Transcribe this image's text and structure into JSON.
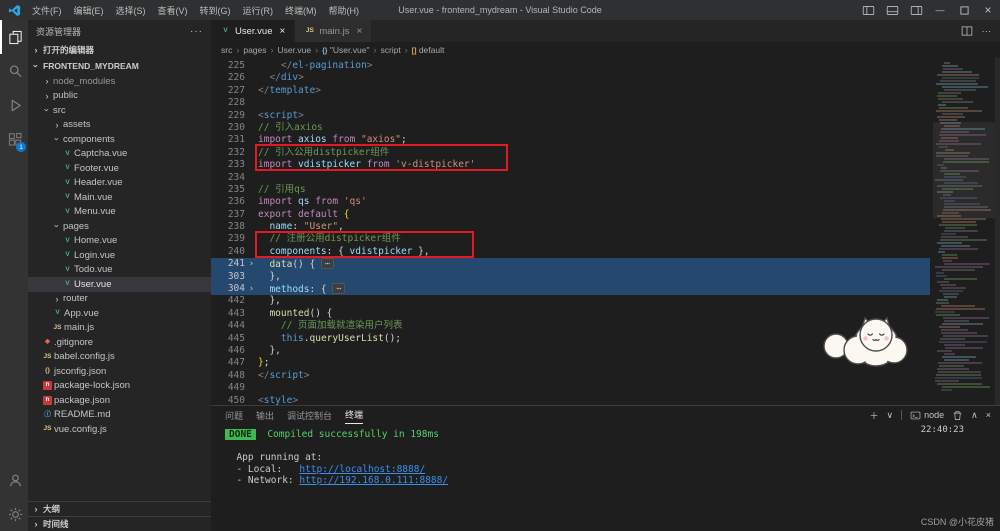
{
  "title_bar": {
    "menus": [
      {
        "name": "file",
        "label": "文件(F)"
      },
      {
        "name": "edit",
        "label": "编辑(E)"
      },
      {
        "name": "selection",
        "label": "选择(S)"
      },
      {
        "name": "view",
        "label": "查看(V)"
      },
      {
        "name": "go",
        "label": "转到(G)"
      },
      {
        "name": "run",
        "label": "运行(R)"
      },
      {
        "name": "terminal",
        "label": "终端(M)"
      },
      {
        "name": "help",
        "label": "帮助(H)"
      }
    ],
    "title": "User.vue - frontend_mydream - Visual Studio Code"
  },
  "activity_bar": {
    "badge": "1"
  },
  "sidebar": {
    "title": "资源管理器",
    "open_editors_label": "打开的编辑器",
    "project_label": "FRONTEND_MYDREAM",
    "outline_label": "大纲",
    "timeline_label": "时间线",
    "tree": [
      {
        "label": "node_modules",
        "type": "folder",
        "depth": 1,
        "expanded": false,
        "dim": true
      },
      {
        "label": "public",
        "type": "folder",
        "depth": 1,
        "expanded": false
      },
      {
        "label": "src",
        "type": "folder",
        "depth": 1,
        "expanded": true
      },
      {
        "label": "assets",
        "type": "folder",
        "depth": 2,
        "expanded": false
      },
      {
        "label": "components",
        "type": "folder",
        "depth": 2,
        "expanded": true
      },
      {
        "label": "Captcha.vue",
        "type": "vue",
        "depth": 3
      },
      {
        "label": "Footer.vue",
        "type": "vue",
        "depth": 3
      },
      {
        "label": "Header.vue",
        "type": "vue",
        "depth": 3
      },
      {
        "label": "Main.vue",
        "type": "vue",
        "depth": 3
      },
      {
        "label": "Menu.vue",
        "type": "vue",
        "depth": 3
      },
      {
        "label": "pages",
        "type": "folder",
        "depth": 2,
        "expanded": true
      },
      {
        "label": "Home.vue",
        "type": "vue",
        "depth": 3
      },
      {
        "label": "Login.vue",
        "type": "vue",
        "depth": 3
      },
      {
        "label": "Todo.vue",
        "type": "vue",
        "depth": 3
      },
      {
        "label": "User.vue",
        "type": "vue",
        "depth": 3,
        "selected": true
      },
      {
        "label": "router",
        "type": "folder",
        "depth": 2,
        "expanded": false
      },
      {
        "label": "App.vue",
        "type": "vue",
        "depth": 2
      },
      {
        "label": "main.js",
        "type": "js",
        "depth": 2
      },
      {
        "label": ".gitignore",
        "type": "git",
        "depth": 1
      },
      {
        "label": "babel.config.js",
        "type": "js",
        "depth": 1
      },
      {
        "label": "jsconfig.json",
        "type": "json",
        "depth": 1
      },
      {
        "label": "package-lock.json",
        "type": "npm",
        "depth": 1
      },
      {
        "label": "package.json",
        "type": "npm",
        "depth": 1
      },
      {
        "label": "README.md",
        "type": "md",
        "depth": 1
      },
      {
        "label": "vue.config.js",
        "type": "js",
        "depth": 1
      }
    ]
  },
  "editor": {
    "tabs": [
      {
        "label": "User.vue",
        "icon": "vue",
        "active": true
      },
      {
        "label": "main.js",
        "icon": "js",
        "active": false
      }
    ],
    "breadcrumb": [
      {
        "label": "src"
      },
      {
        "label": "pages"
      },
      {
        "label": "User.vue"
      },
      {
        "label": "\"User.vue\"",
        "icon": "{}",
        "icon_color": "#8fb8d8"
      },
      {
        "label": "script"
      },
      {
        "label": "default",
        "icon": "[]",
        "icon_color": "#e8ab53"
      }
    ],
    "lines": [
      {
        "num": 225,
        "tokens": [
          [
            "p",
            "    </"
          ],
          [
            "t",
            "el-pagination"
          ],
          [
            "p",
            ">"
          ]
        ]
      },
      {
        "num": 226,
        "tokens": [
          [
            "p",
            "  </"
          ],
          [
            "t",
            "div"
          ],
          [
            "p",
            ">"
          ]
        ]
      },
      {
        "num": 227,
        "tokens": [
          [
            "p",
            "</"
          ],
          [
            "t",
            "template"
          ],
          [
            "p",
            ">"
          ]
        ]
      },
      {
        "num": 228,
        "tokens": []
      },
      {
        "num": 229,
        "tokens": [
          [
            "p",
            "<"
          ],
          [
            "t",
            "script"
          ],
          [
            "p",
            ">"
          ]
        ]
      },
      {
        "num": 230,
        "tokens": [
          [
            "c",
            "// 引入axios"
          ]
        ]
      },
      {
        "num": 231,
        "tokens": [
          [
            "k",
            "import "
          ],
          [
            "v",
            "axios "
          ],
          [
            "k",
            "from "
          ],
          [
            "s",
            "\"axios\""
          ],
          [
            "w",
            ";"
          ]
        ]
      },
      {
        "num": 232,
        "tokens": [
          [
            "c",
            "// 引入公用distpicker组件"
          ]
        ]
      },
      {
        "num": 233,
        "tokens": [
          [
            "k",
            "import "
          ],
          [
            "v",
            "vdistpicker "
          ],
          [
            "k",
            "from "
          ],
          [
            "s",
            "'v-distpicker'"
          ]
        ]
      },
      {
        "num": 234,
        "tokens": []
      },
      {
        "num": 235,
        "tokens": [
          [
            "c",
            "// 引用qs"
          ]
        ]
      },
      {
        "num": 236,
        "tokens": [
          [
            "k",
            "import "
          ],
          [
            "v",
            "qs "
          ],
          [
            "k",
            "from "
          ],
          [
            "s",
            "'qs'"
          ]
        ]
      },
      {
        "num": 237,
        "tokens": [
          [
            "k",
            "export default "
          ],
          [
            "y",
            "{"
          ]
        ]
      },
      {
        "num": 238,
        "tokens": [
          [
            "v",
            "  name"
          ],
          [
            "w",
            ": "
          ],
          [
            "s",
            "\"User\""
          ],
          [
            "w",
            ","
          ]
        ]
      },
      {
        "num": 239,
        "tokens": [
          [
            "c",
            "  // 注册公用distpicker组件"
          ]
        ]
      },
      {
        "num": 240,
        "tokens": [
          [
            "v",
            "  components"
          ],
          [
            "w",
            ": { "
          ],
          [
            "v",
            "vdistpicker"
          ],
          [
            "w",
            " },"
          ]
        ]
      },
      {
        "num": 241,
        "sel": true,
        "fold": true,
        "tokens": [
          [
            "f",
            "  data"
          ],
          [
            "w",
            "() { "
          ],
          [
            "fold",
            "⋯"
          ]
        ]
      },
      {
        "num": 303,
        "sel": true,
        "tokens": [
          [
            "w",
            "  },"
          ]
        ]
      },
      {
        "num": 304,
        "sel": true,
        "fold": true,
        "tokens": [
          [
            "v",
            "  methods"
          ],
          [
            "w",
            ": { "
          ],
          [
            "fold",
            "⋯"
          ]
        ]
      },
      {
        "num": 442,
        "tokens": [
          [
            "w",
            "  },"
          ]
        ]
      },
      {
        "num": 443,
        "tokens": [
          [
            "f",
            "  mounted"
          ],
          [
            "w",
            "() {"
          ]
        ]
      },
      {
        "num": 444,
        "tokens": [
          [
            "c",
            "    // 页面加载就渲染用户列表"
          ]
        ]
      },
      {
        "num": 445,
        "tokens": [
          [
            "t",
            "    this"
          ],
          [
            "w",
            "."
          ],
          [
            "f",
            "queryUserList"
          ],
          [
            "w",
            "();"
          ]
        ]
      },
      {
        "num": 446,
        "tokens": [
          [
            "w",
            "  },"
          ]
        ]
      },
      {
        "num": 447,
        "tokens": [
          [
            "y",
            "}"
          ],
          [
            "w",
            ";"
          ]
        ]
      },
      {
        "num": 448,
        "tokens": [
          [
            "p",
            "</"
          ],
          [
            "t",
            "script"
          ],
          [
            "p",
            ">"
          ]
        ]
      },
      {
        "num": 449,
        "tokens": []
      },
      {
        "num": 450,
        "tokens": [
          [
            "p",
            "<"
          ],
          [
            "t",
            "style"
          ],
          [
            "p",
            ">"
          ]
        ]
      }
    ]
  },
  "panel": {
    "tabs": [
      {
        "name": "problems",
        "label": "问题",
        "active": false
      },
      {
        "name": "output",
        "label": "输出",
        "active": false
      },
      {
        "name": "debug-console",
        "label": "调试控制台",
        "active": false
      },
      {
        "name": "terminal",
        "label": "终端",
        "active": true
      }
    ],
    "shell_label": "node",
    "timestamp": "22:40:23",
    "terminal": [
      {
        "tokens": [
          [
            "badge",
            "DONE"
          ],
          [
            "g",
            "  Compiled successfully in 198ms"
          ]
        ]
      },
      {
        "tokens": []
      },
      {
        "tokens": [
          [
            "w",
            "  App running at:"
          ]
        ]
      },
      {
        "tokens": [
          [
            "w",
            "  - Local:   "
          ],
          [
            "link",
            "http://localhost:8888/"
          ]
        ]
      },
      {
        "tokens": [
          [
            "w",
            "  - Network: "
          ],
          [
            "link",
            "http://192.168.0.111:8888/"
          ]
        ]
      }
    ]
  },
  "watermark": "CSDN @小花皮猪"
}
